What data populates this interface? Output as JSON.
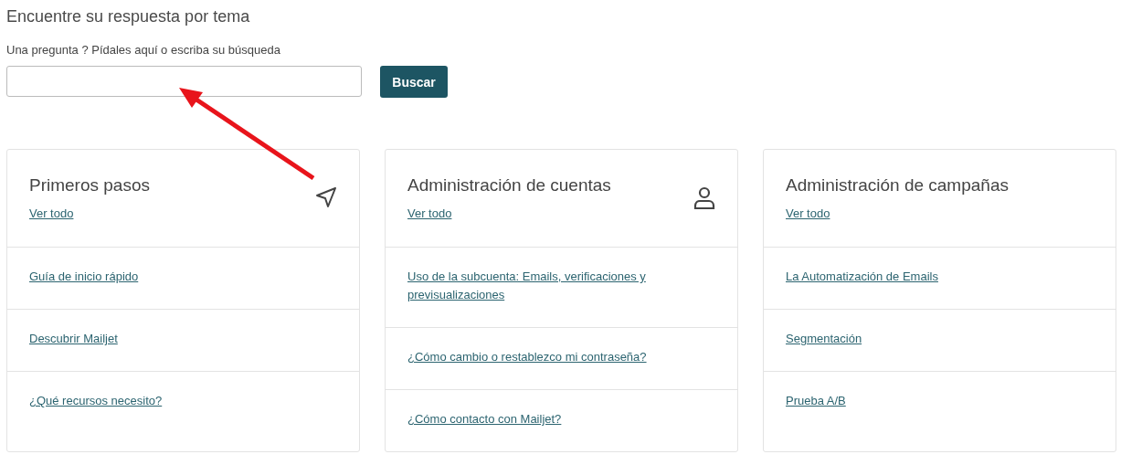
{
  "heading": "Encuentre su respuesta por tema",
  "search": {
    "label": "Una pregunta ? Pídales aquí o escriba su búsqueda",
    "button": "Buscar"
  },
  "cards": [
    {
      "title": "Primeros pasos",
      "kind": "send",
      "see_all": "Ver todo",
      "links": [
        "Guía de inicio rápido",
        "Descubrir Mailjet",
        "¿Qué recursos necesito?"
      ]
    },
    {
      "title": "Administración de cuentas",
      "kind": "person",
      "see_all": "Ver todo",
      "links": [
        "Uso de la subcuenta: Emails, verificaciones y previsualizaciones",
        "¿Cómo cambio o restablezco mi contraseña?",
        "¿Cómo contacto con Mailjet?"
      ]
    },
    {
      "title": "Administración de campañas",
      "kind": "plain",
      "see_all": "Ver todo",
      "links": [
        "La Automatización de Emails",
        "Segmentación",
        "Prueba A/B"
      ]
    }
  ],
  "annotation": {
    "kind": "arrow"
  }
}
